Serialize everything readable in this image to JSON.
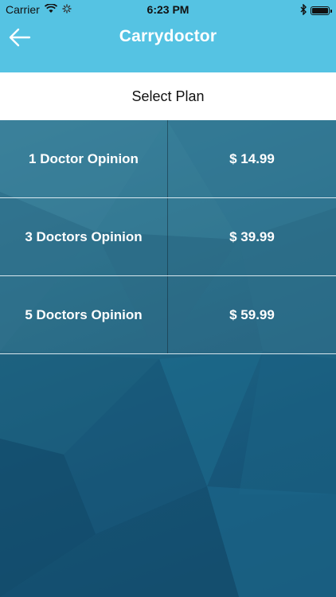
{
  "status_bar": {
    "carrier": "Carrier",
    "time": "6:23 PM"
  },
  "nav": {
    "title": "Carrydoctor",
    "back_icon": "arrow-left-icon"
  },
  "select_plan": {
    "label": "Select Plan"
  },
  "plans": [
    {
      "name": "1 Doctor Opinion",
      "price": "$ 14.99"
    },
    {
      "name": "3 Doctors Opinion",
      "price": "$ 39.99"
    },
    {
      "name": "5 Doctors Opinion",
      "price": "$ 59.99"
    }
  ],
  "colors": {
    "header": "#55c3e3",
    "background": "#1f5f7c",
    "text_light": "#ffffff"
  }
}
